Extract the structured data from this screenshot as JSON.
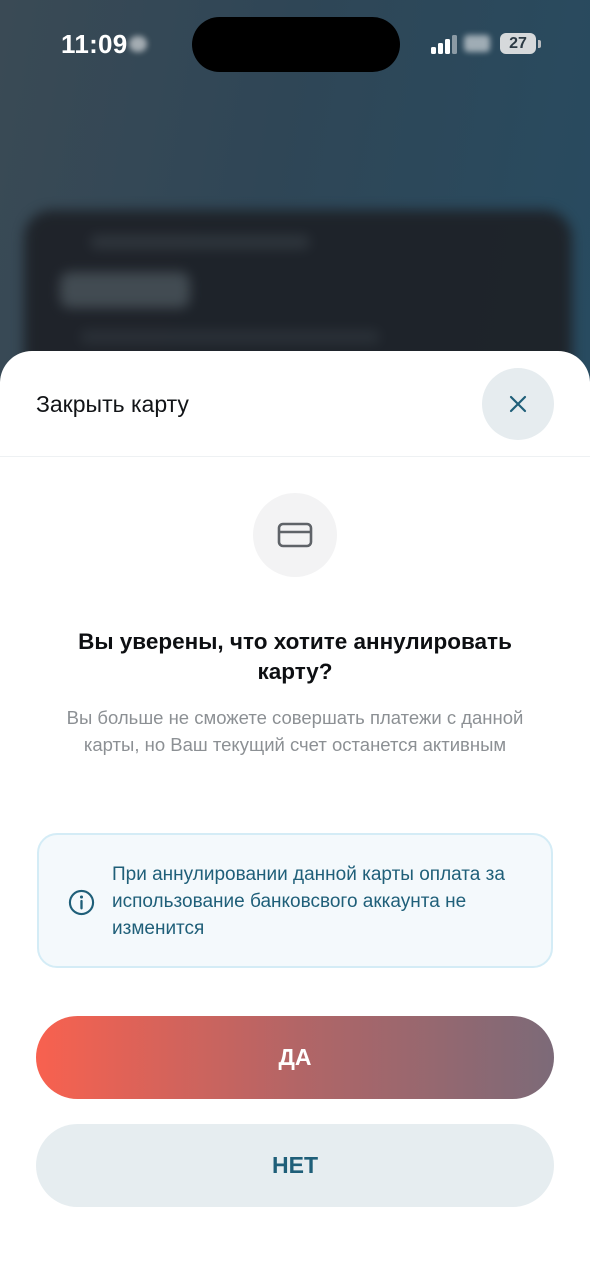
{
  "status_bar": {
    "time": "11:09",
    "battery": "27"
  },
  "sheet": {
    "title": "Закрыть карту",
    "close_icon": "close-icon",
    "card_icon": "credit-card-icon",
    "question": "Вы уверены, что хотите аннулировать карту?",
    "subtitle": "Вы больше не сможете совершать платежи с данной карты, но Ваш текущий счет останется активным",
    "info": {
      "icon": "info-icon",
      "text": "При аннулировании данной карты оплата за использование банковсвого аккаунта не изменится"
    },
    "yes_label": "ДА",
    "no_label": "НЕТ"
  },
  "colors": {
    "accent_text": "#1f5f79",
    "yes_gradient_start": "#f8614f",
    "yes_gradient_end": "#7c6a78",
    "no_button_bg": "#e6edf0",
    "info_border": "#d4ecf6"
  }
}
